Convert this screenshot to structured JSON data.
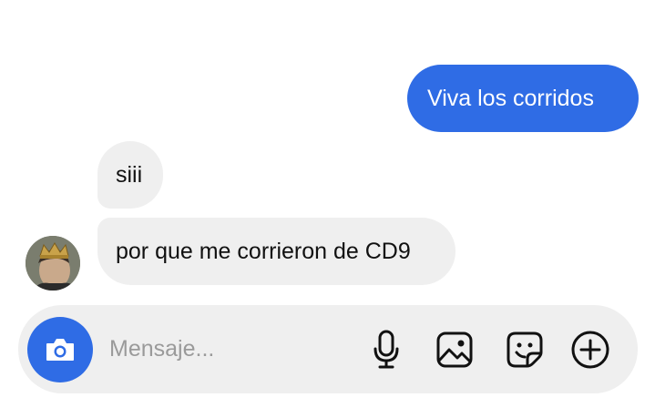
{
  "messages": [
    {
      "direction": "outgoing",
      "text": "Viva los corridos"
    },
    {
      "direction": "incoming",
      "text": "siii"
    },
    {
      "direction": "incoming",
      "text": "por que me corrieron de CD9"
    }
  ],
  "composer": {
    "placeholder": "Mensaje..."
  },
  "icons": {
    "camera": "camera-icon",
    "microphone": "microphone-icon",
    "gallery": "gallery-icon",
    "sticker": "sticker-icon",
    "add": "plus-circle-icon"
  },
  "colors": {
    "accent": "#2f6ce5",
    "incoming_bubble": "#efefef",
    "composer_bg": "#efefef"
  }
}
